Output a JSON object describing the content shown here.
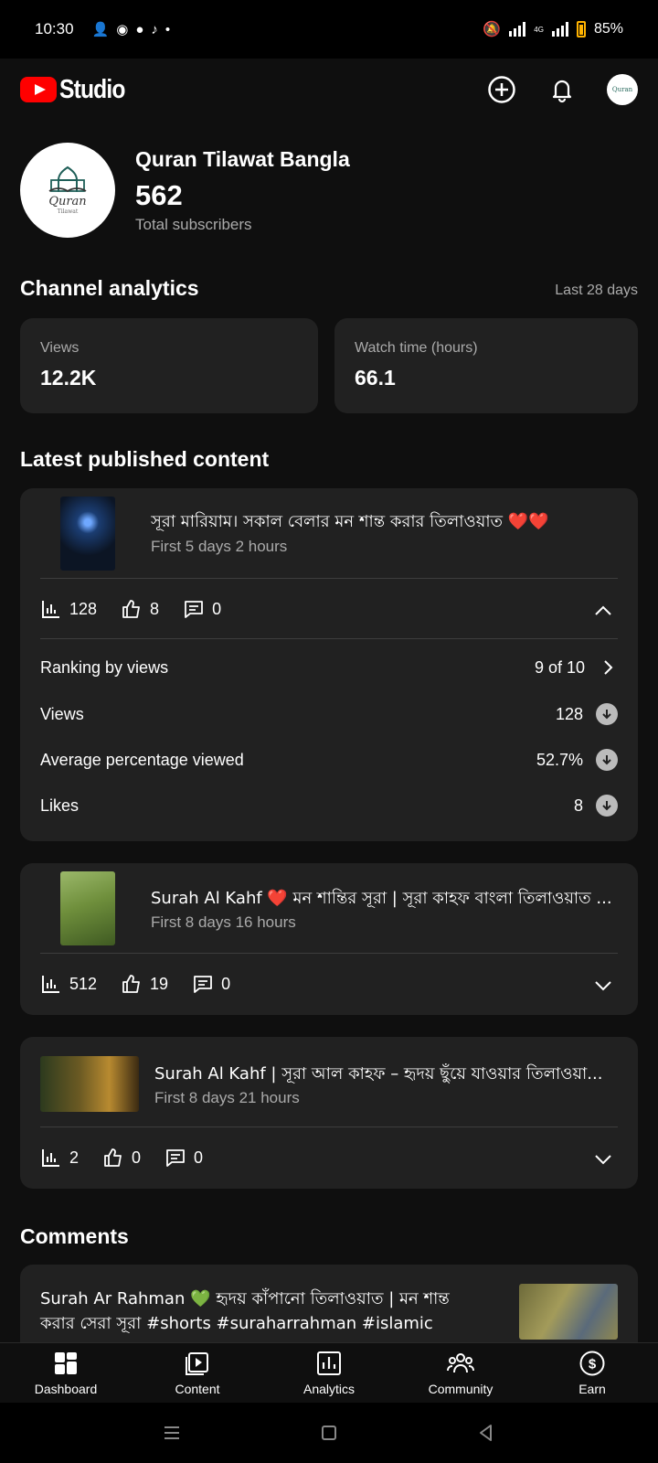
{
  "status_bar": {
    "time": "10:30",
    "battery": "85%",
    "network_label": "4G"
  },
  "app": {
    "logo_text": "Studio"
  },
  "channel": {
    "avatar_title": "Quran",
    "avatar_subtitle": "Tilawat",
    "name": "Quran Tilawat Bangla",
    "subscribers": "562",
    "subscribers_label": "Total subscribers"
  },
  "analytics": {
    "title": "Channel analytics",
    "period": "Last 28 days",
    "cards": [
      {
        "label": "Views",
        "value": "12.2K"
      },
      {
        "label": "Watch time (hours)",
        "value": "66.1"
      }
    ]
  },
  "latest": {
    "title": "Latest published content",
    "items": [
      {
        "title": "সূরা মারিয়াম। সকাল বেলার মন শান্ত করার তিলাওয়াত ❤️❤️",
        "subtitle": "First 5 days 2 hours",
        "views": "128",
        "likes": "8",
        "comments": "0",
        "expanded": true,
        "details": [
          {
            "label": "Ranking by views",
            "value": "9 of 10",
            "icon": "chevron-right-icon"
          },
          {
            "label": "Views",
            "value": "128",
            "icon": "down-arrow-icon"
          },
          {
            "label": "Average percentage viewed",
            "value": "52.7%",
            "icon": "down-arrow-icon"
          },
          {
            "label": "Likes",
            "value": "8",
            "icon": "down-arrow-icon"
          }
        ]
      },
      {
        "title": "Surah Al Kahf ❤️ মন শান্তির সূরা | সূরা কাহফ বাংলা তিলাওয়াত ...",
        "subtitle": "First 8 days 16 hours",
        "views": "512",
        "likes": "19",
        "comments": "0",
        "expanded": false
      },
      {
        "title": "Surah Al Kahf | সূরা আল কাহফ – হৃদয় ছুঁয়ে যাওয়ার তিলাওয়া...",
        "subtitle": "First 8 days 21 hours",
        "views": "2",
        "likes": "0",
        "comments": "0",
        "expanded": false
      }
    ]
  },
  "comments": {
    "title": "Comments",
    "video_title": "Surah Ar Rahman 💚 হৃদয় কাঁপানো তিলাওয়াত | মন শান্ত করার সেরা সূরা #shorts #suraharrahman #islamic"
  },
  "bottom_nav": [
    {
      "label": "Dashboard",
      "icon": "dashboard-icon"
    },
    {
      "label": "Content",
      "icon": "content-icon"
    },
    {
      "label": "Analytics",
      "icon": "analytics-icon"
    },
    {
      "label": "Community",
      "icon": "community-icon"
    },
    {
      "label": "Earn",
      "icon": "earn-icon"
    }
  ]
}
